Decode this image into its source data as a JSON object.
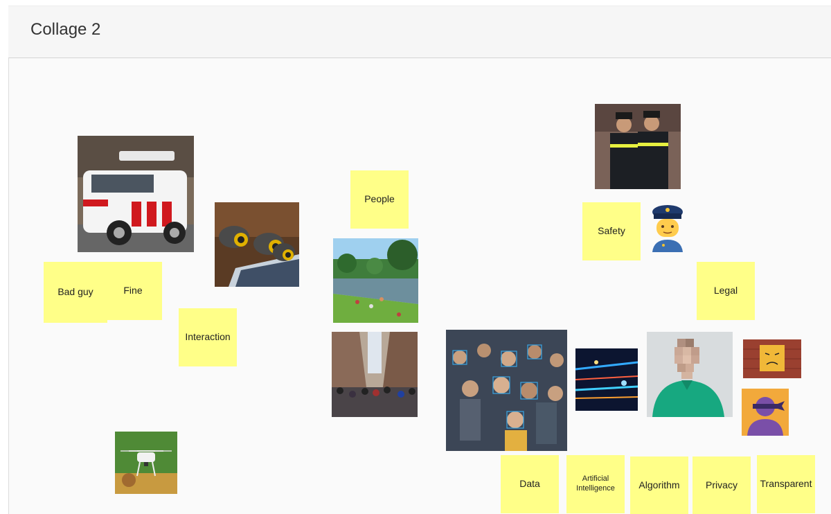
{
  "board": {
    "title": "Collage 2"
  },
  "notes": {
    "people": "People",
    "safety": "Safety",
    "legal": "Legal",
    "bad_guy": "Bad guy",
    "fine": "Fine",
    "interaction": "Interaction",
    "data": "Data",
    "ai": "Artificial Intelligence",
    "algorithm": "Algorithm",
    "privacy": "Privacy",
    "transparent": "Transparent"
  },
  "images": [
    "police-car-photo",
    "security-cameras-photo",
    "park-pond-photo",
    "crowded-street-photo",
    "face-recognition-crowd-photo",
    "police-officers-photo",
    "police-officer-emoji",
    "light-trails-photo",
    "pixelated-face-photo",
    "angry-sticky-note-photo",
    "blindfolded-person-icon",
    "drone-photo"
  ],
  "colors": {
    "sticky": "#ffff88",
    "canvas": "#fafafa"
  }
}
